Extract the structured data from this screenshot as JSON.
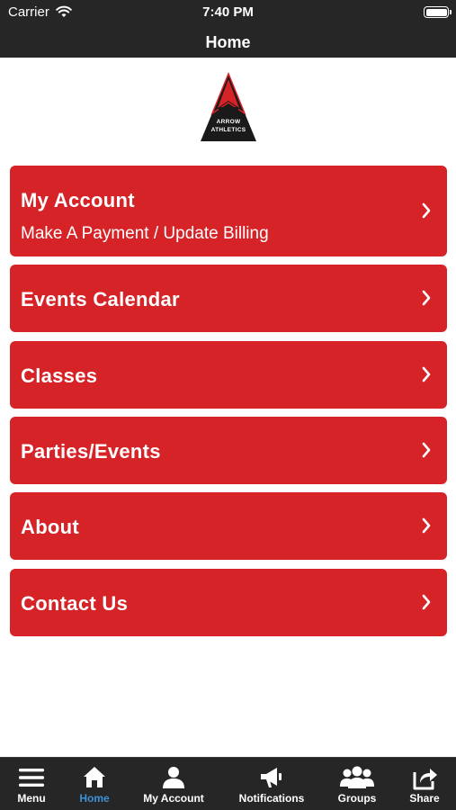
{
  "status_bar": {
    "carrier": "Carrier",
    "time": "7:40 PM"
  },
  "nav": {
    "title": "Home"
  },
  "logo": {
    "line1": "ARROW",
    "line2": "ATHLETICS"
  },
  "menu": [
    {
      "title": "My Account",
      "subtitle": "Make A Payment / Update Billing"
    },
    {
      "title": "Events Calendar"
    },
    {
      "title": "Classes"
    },
    {
      "title": "Parties/Events"
    },
    {
      "title": "About"
    },
    {
      "title": "Contact Us"
    }
  ],
  "tabs": [
    {
      "label": "Menu",
      "icon": "hamburger-icon"
    },
    {
      "label": "Home",
      "icon": "home-icon",
      "active": true
    },
    {
      "label": "My Account",
      "icon": "person-icon"
    },
    {
      "label": "Notifications",
      "icon": "megaphone-icon"
    },
    {
      "label": "Groups",
      "icon": "group-icon"
    },
    {
      "label": "Share",
      "icon": "share-icon"
    }
  ],
  "colors": {
    "card": "#d52328",
    "bar": "#262626",
    "active_tab": "#3d92d8"
  }
}
